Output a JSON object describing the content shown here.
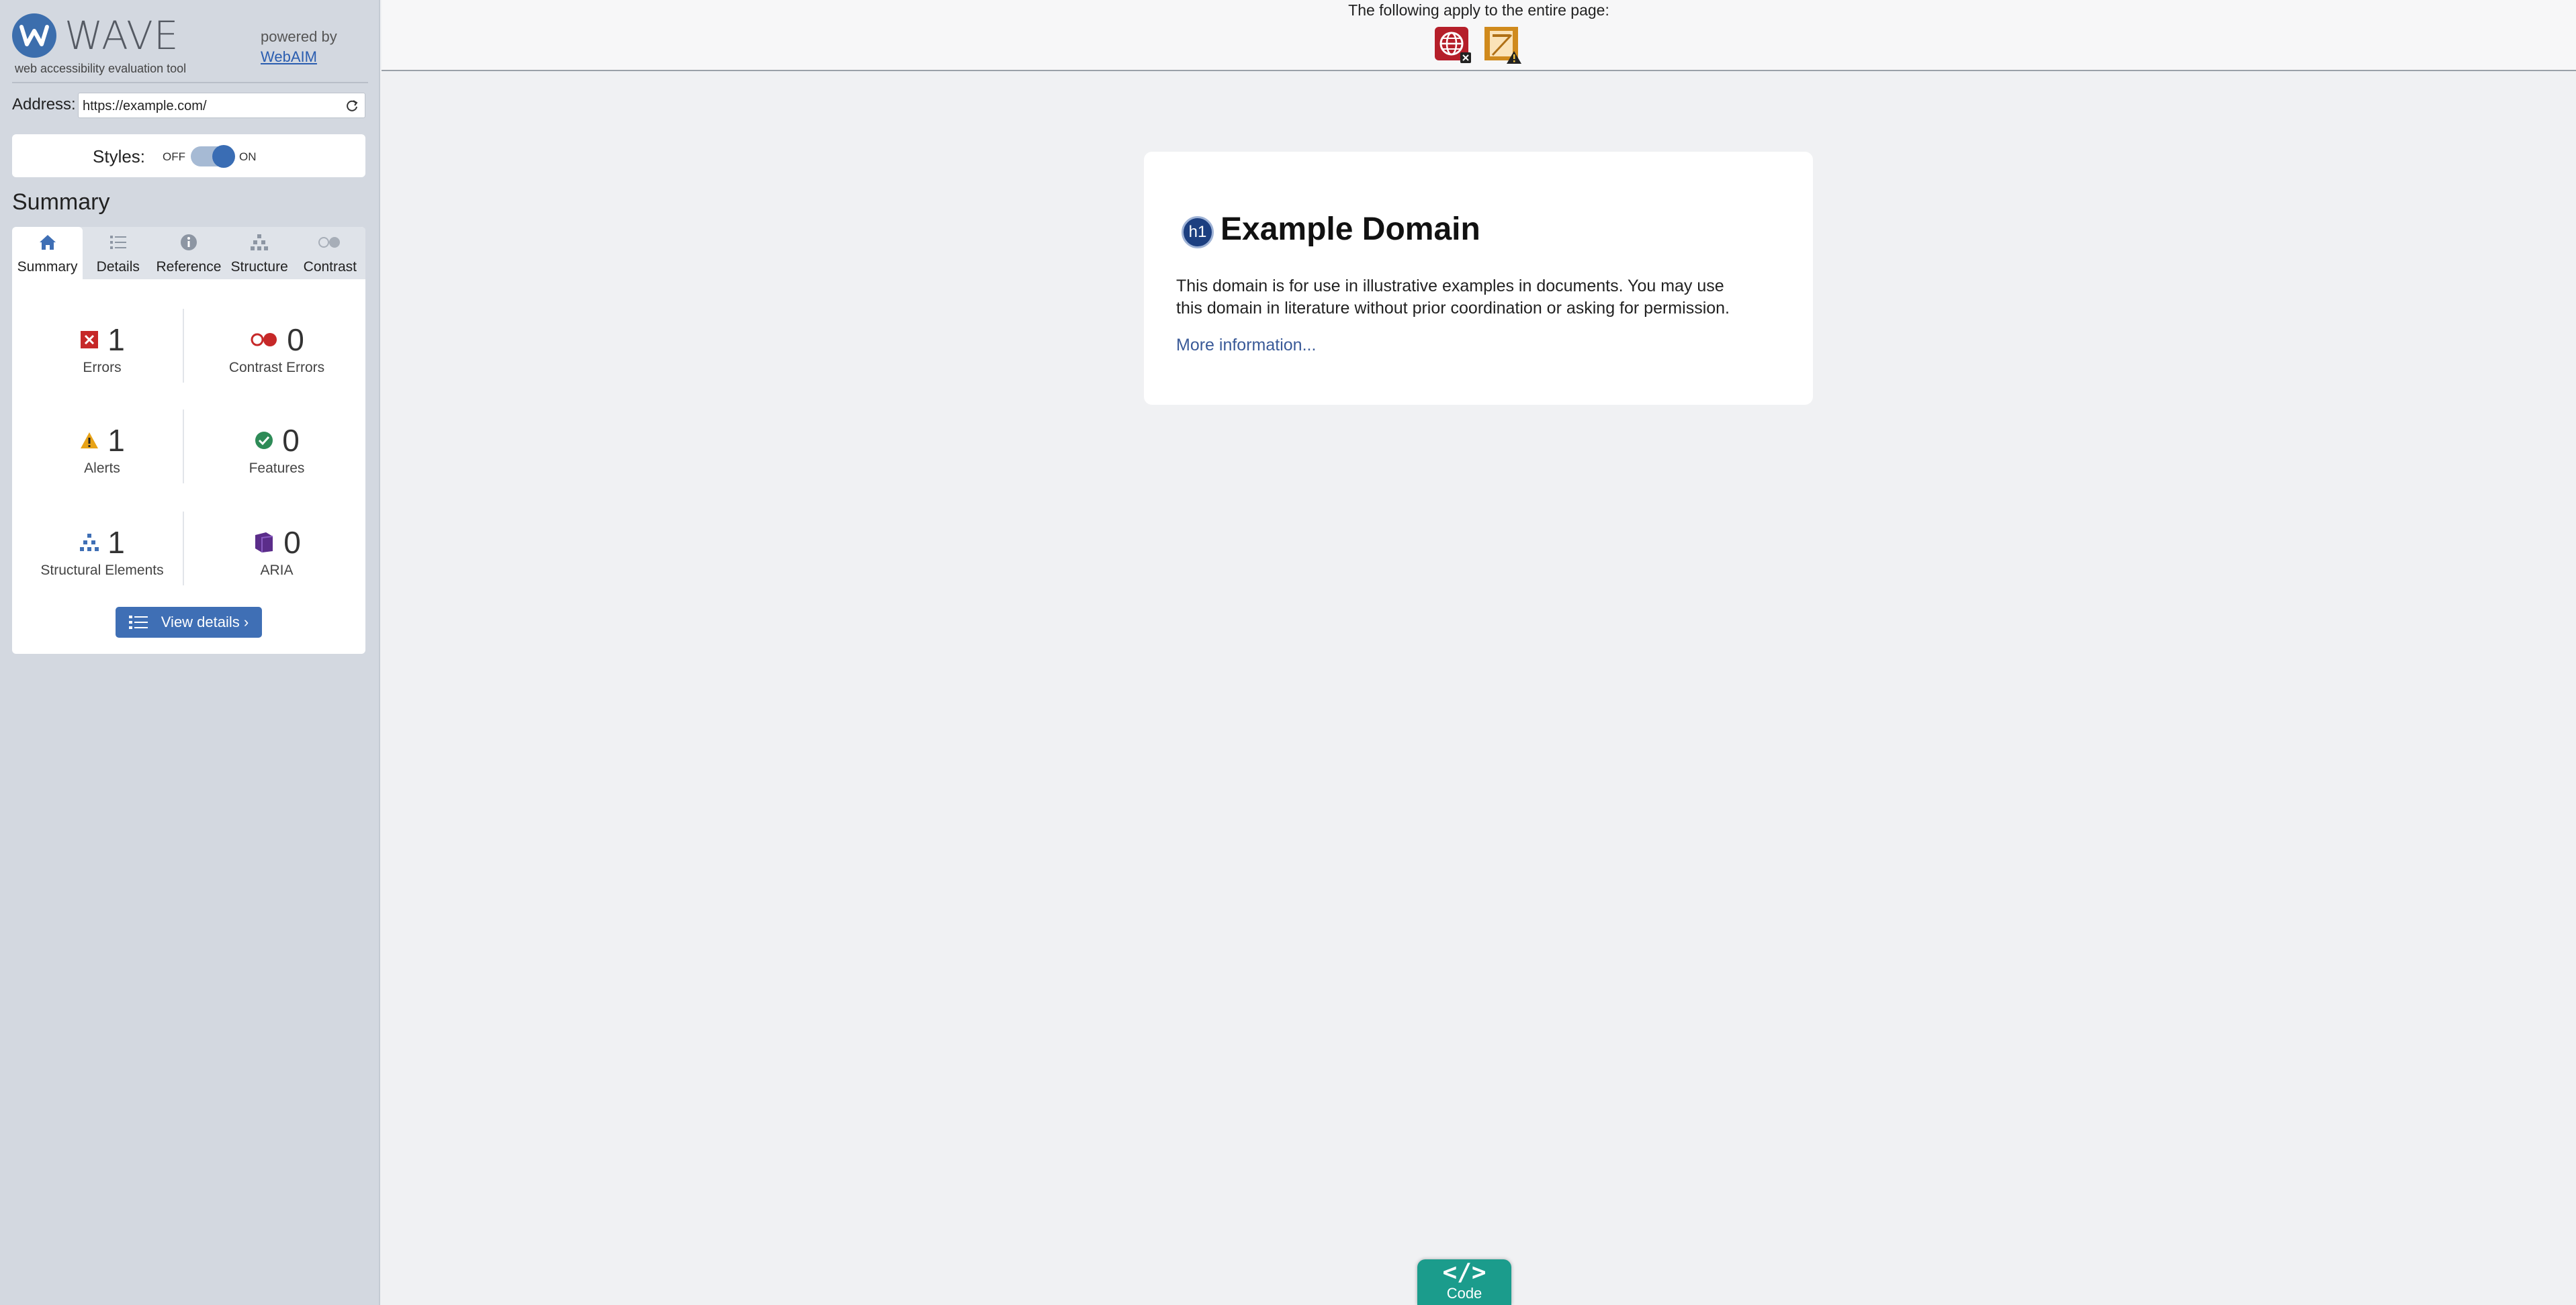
{
  "brand": {
    "logo_letter": "W",
    "name": "WAVE",
    "tagline": "web accessibility evaluation tool",
    "powered_by": "powered by",
    "powered_link": "WebAIM"
  },
  "address": {
    "label": "Address:",
    "value": "https://example.com/"
  },
  "styles": {
    "label": "Styles:",
    "off": "OFF",
    "on": "ON",
    "state": "on"
  },
  "summary_title": "Summary",
  "tabs": [
    {
      "label": "Summary",
      "icon": "home-icon",
      "active": true
    },
    {
      "label": "Details",
      "icon": "list-icon",
      "active": false
    },
    {
      "label": "Reference",
      "icon": "info-icon",
      "active": false
    },
    {
      "label": "Structure",
      "icon": "hierarchy-icon",
      "active": false
    },
    {
      "label": "Contrast",
      "icon": "contrast-icon",
      "active": false
    }
  ],
  "stats": {
    "errors": {
      "count": "1",
      "label": "Errors"
    },
    "contrast_errors": {
      "count": "0",
      "label": "Contrast Errors"
    },
    "alerts": {
      "count": "1",
      "label": "Alerts"
    },
    "features": {
      "count": "0",
      "label": "Features"
    },
    "structural": {
      "count": "1",
      "label": "Structural Elements"
    },
    "aria": {
      "count": "0",
      "label": "ARIA"
    }
  },
  "view_details": "View details ›",
  "topbar": {
    "text": "The following apply to the entire page:",
    "icons": [
      "language-error-icon",
      "title-alert-icon"
    ]
  },
  "content": {
    "h1_badge": "h1",
    "heading": "Example Domain",
    "paragraph": "This domain is for use in illustrative examples in documents. You may use this domain in literature without prior coordination or asking for permission.",
    "link": "More information..."
  },
  "code_tab": {
    "glyph": "</>",
    "label": "Code"
  },
  "colors": {
    "sidebar_bg": "#d3d8e0",
    "accent_blue": "#3f6fb5",
    "error_red": "#c62828",
    "alert_orange": "#e8a317",
    "feature_green": "#2e8b57",
    "aria_purple": "#5b2d8a",
    "code_teal": "#1b9c8c"
  }
}
